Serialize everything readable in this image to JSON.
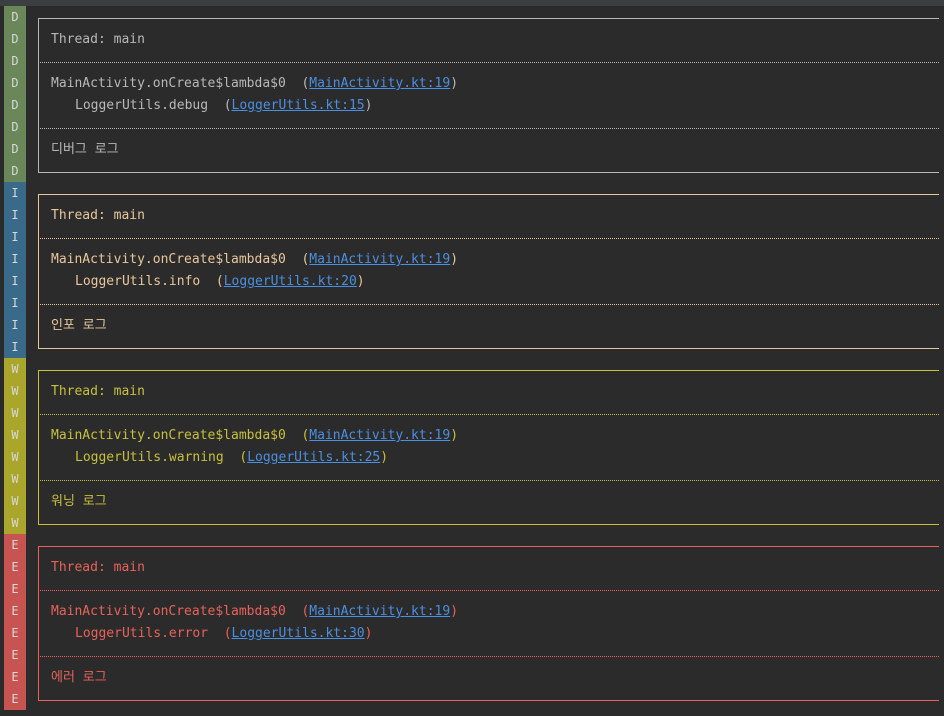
{
  "colors": {
    "debug": "#b8b8b8",
    "info": "#e8c79c",
    "warning": "#c7c03c",
    "error": "#e8625a",
    "link": "#4a8fe0",
    "gutter_debug": "#6a8759",
    "gutter_info": "#3a6a8a",
    "gutter_warning": "#a9a62b",
    "gutter_error": "#c75450"
  },
  "blocks": [
    {
      "level": "D",
      "thread": "Thread: main",
      "caller": "MainActivity.onCreate$lambda$0",
      "caller_link": "MainActivity.kt:19",
      "method": "LoggerUtils.debug",
      "method_link": "LoggerUtils.kt:15",
      "message": "디버그 로그"
    },
    {
      "level": "I",
      "thread": "Thread: main",
      "caller": "MainActivity.onCreate$lambda$0",
      "caller_link": "MainActivity.kt:19",
      "method": "LoggerUtils.info",
      "method_link": "LoggerUtils.kt:20",
      "message": "인포 로그"
    },
    {
      "level": "W",
      "thread": "Thread: main",
      "caller": "MainActivity.onCreate$lambda$0",
      "caller_link": "MainActivity.kt:19",
      "method": "LoggerUtils.warning",
      "method_link": "LoggerUtils.kt:25",
      "message": "워닝 로그"
    },
    {
      "level": "E",
      "thread": "Thread: main",
      "caller": "MainActivity.onCreate$lambda$0",
      "caller_link": "MainActivity.kt:19",
      "method": "LoggerUtils.error",
      "method_link": "LoggerUtils.kt:30",
      "message": "에러 로그"
    }
  ]
}
